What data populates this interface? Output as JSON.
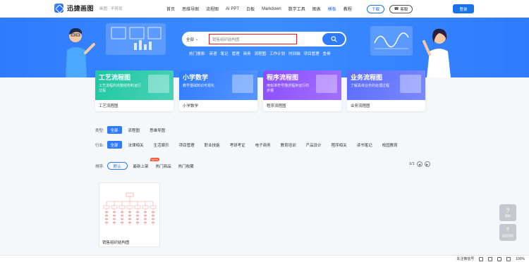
{
  "brand": {
    "name": "迅捷画图",
    "slogan": "画图 · 不将就"
  },
  "nav": [
    "首页",
    "思维导图",
    "流程图",
    "AI PPT",
    "白板",
    "Markdown",
    "数学工具",
    "图表",
    "模板",
    "教程"
  ],
  "nav_active_index": 8,
  "header_buttons": {
    "download": "下载",
    "feedback": "客服",
    "login": "登录"
  },
  "search": {
    "scope": "全部",
    "value": "销售组织结构图",
    "hot_label": "热门搜索:",
    "hot_words": [
      "英语",
      "笔记",
      "管理",
      "商务",
      "流程图",
      "工作计划",
      "时间轴",
      "项目管理",
      "鱼骨"
    ]
  },
  "cards": [
    {
      "title": "工艺流程图",
      "desc": "工艺流程的完整结构和运行过程",
      "label": "工艺流程图",
      "color": "#1dc7a3"
    },
    {
      "title": "小学数学",
      "desc": "教学基础知识可视化",
      "label": "小学数学",
      "color": "#2f7bff"
    },
    {
      "title": "程序流程图",
      "desc": "用标准符号描述程序运行的步骤",
      "label": "程序流程图",
      "color": "#8a4dff"
    },
    {
      "title": "业务流程图",
      "desc": "了解具体业务的处理过程",
      "label": "业务流程图",
      "color": "#5a6cff"
    }
  ],
  "type_filter": {
    "label": "类型:",
    "options": [
      "全部",
      "流程图",
      "思维导图"
    ]
  },
  "industry_filter": {
    "label": "行业:",
    "options": [
      "全部",
      "法律相关",
      "生活娱乐",
      "项目管理",
      "职业技能",
      "考研考证",
      "电子商务",
      "教育培训",
      "产品设计",
      "程序相关",
      "读书笔记",
      "校园教育"
    ]
  },
  "sort": {
    "label": "排序:",
    "options": [
      "默认",
      "最新上架",
      "热门商品",
      "热门收藏"
    ],
    "new_badge": "NEW"
  },
  "pager": {
    "text": "1/1"
  },
  "templates": [
    {
      "name": "销售组织结构图"
    }
  ],
  "float_buttons": {
    "help": "帮助",
    "top": "返回顶部"
  },
  "statusbar": {
    "ime": "关注微信号",
    "zoom": "100%"
  }
}
